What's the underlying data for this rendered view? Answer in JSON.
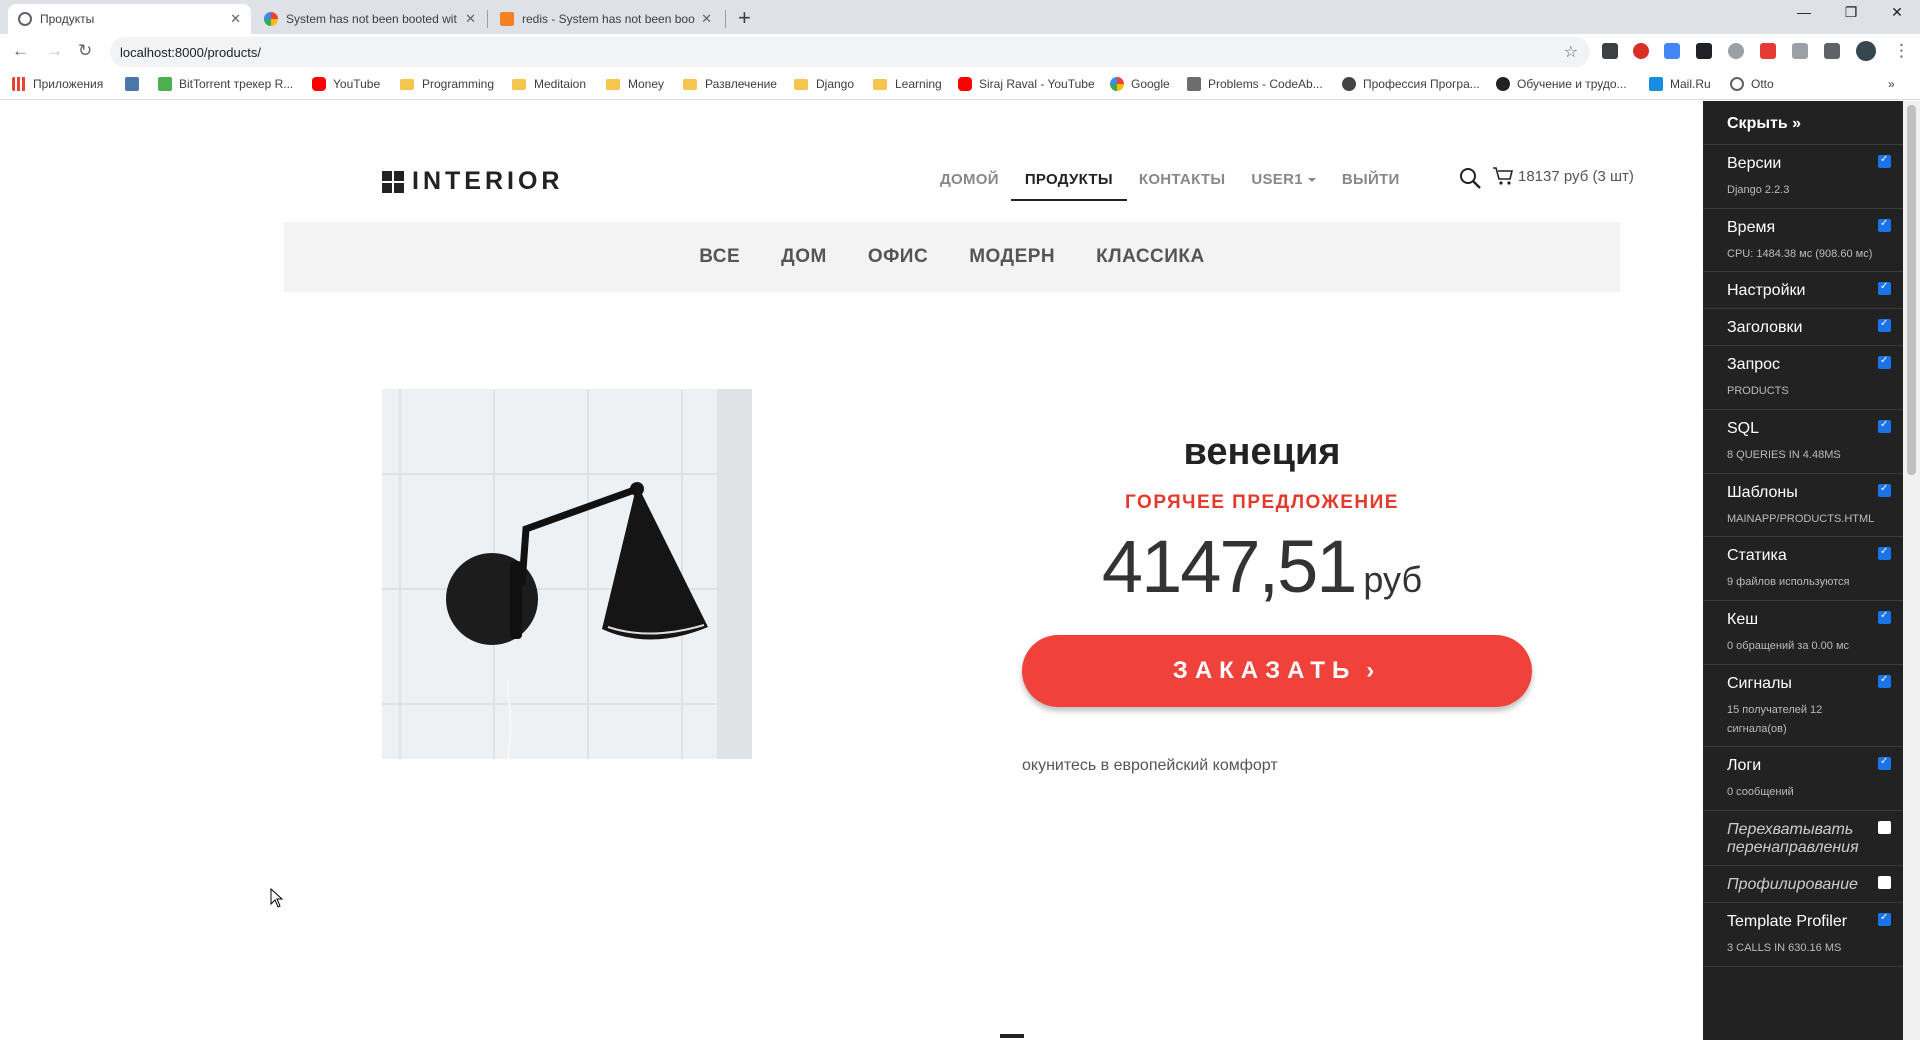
{
  "browser": {
    "tabs": [
      {
        "title": "Продукты",
        "active": true
      },
      {
        "title": "System has not been booted wit",
        "active": false
      },
      {
        "title": "redis - System has not been boo",
        "active": false
      }
    ],
    "url": "localhost:8000/products/",
    "bookmarks": [
      {
        "label": "Приложения",
        "icon": "apps-icon"
      },
      {
        "label": "",
        "icon": "vk-icon"
      },
      {
        "label": "BitTorrent трекер R...",
        "icon": "torrent-icon"
      },
      {
        "label": "YouTube",
        "icon": "youtube-icon"
      },
      {
        "label": "Programming",
        "icon": "folder-icon"
      },
      {
        "label": "Meditaion",
        "icon": "folder-icon"
      },
      {
        "label": "Money",
        "icon": "folder-icon"
      },
      {
        "label": "Развлечение",
        "icon": "folder-icon"
      },
      {
        "label": "Django",
        "icon": "folder-icon"
      },
      {
        "label": "Learning",
        "icon": "folder-icon"
      },
      {
        "label": "Siraj Raval - YouTube",
        "icon": "youtube-icon"
      },
      {
        "label": "Google",
        "icon": "google-icon"
      },
      {
        "label": "Problems - CodeAb...",
        "icon": "codeabbey-icon"
      },
      {
        "label": "Профессия Програ...",
        "icon": "site-icon"
      },
      {
        "label": "Обучение и трудо...",
        "icon": "site-icon"
      },
      {
        "label": "Mail.Ru",
        "icon": "mailru-icon"
      },
      {
        "label": "Otto",
        "icon": "globe-icon"
      }
    ],
    "bookmarks_more": "»"
  },
  "site": {
    "logo": "INTERIOR",
    "nav": [
      "ДОМОЙ",
      "ПРОДУКТЫ",
      "КОНТАКТЫ",
      "USER1",
      "ВЫЙТИ"
    ],
    "cart": "18137 руб (3 шт)",
    "categories": [
      "ВСЕ",
      "ДОМ",
      "ОФИС",
      "МОДЕРН",
      "КЛАССИКА"
    ]
  },
  "product": {
    "title": "венеция",
    "hot": "ГОРЯЧЕЕ ПРЕДЛОЖЕНИЕ",
    "price": "4147,51",
    "currency": "руб",
    "order_label": "ЗАКАЗАТЬ",
    "description": "окунитесь в европейский комфорт"
  },
  "debug_toolbar": {
    "hide_label": "Скрыть »",
    "panels": [
      {
        "title": "Версии",
        "sub": "Django 2.2.3",
        "on": true
      },
      {
        "title": "Время",
        "sub": "CPU: 1484.38 мс (908.60 мс)",
        "on": true
      },
      {
        "title": "Настройки",
        "sub": "",
        "on": true
      },
      {
        "title": "Заголовки",
        "sub": "",
        "on": true
      },
      {
        "title": "Запрос",
        "sub": "PRODUCTS",
        "on": true
      },
      {
        "title": "SQL",
        "sub": "8 QUERIES IN 4.48MS",
        "on": true
      },
      {
        "title": "Шаблоны",
        "sub": "MAINAPP/PRODUCTS.HTML",
        "on": true
      },
      {
        "title": "Статика",
        "sub": "9 файлов используются",
        "on": true
      },
      {
        "title": "Кеш",
        "sub": "0 обращений за 0.00 мс",
        "on": true
      },
      {
        "title": "Сигналы",
        "sub": "15 получателей 12 сигнала(ов)",
        "on": true
      },
      {
        "title": "Логи",
        "sub": "0 сообщений",
        "on": true
      },
      {
        "title": "Перехватывать перенаправления",
        "sub": "",
        "on": false
      },
      {
        "title": "Профилирование",
        "sub": "",
        "on": false
      },
      {
        "title": "Template Profiler",
        "sub": "3 CALLS IN 630.16 MS",
        "on": true
      }
    ]
  },
  "colors": {
    "accent": "#f0413a",
    "hot": "#e5392c",
    "toolbar_bg": "#222222"
  }
}
